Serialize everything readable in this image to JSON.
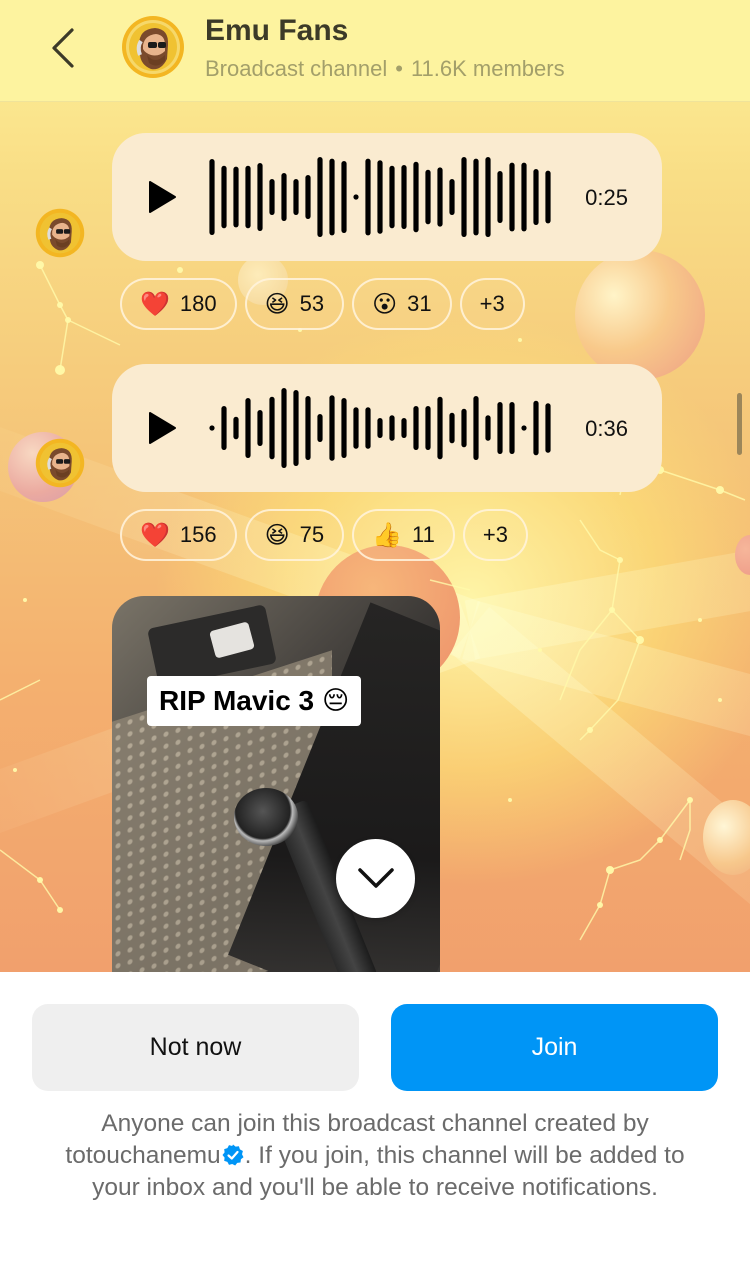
{
  "header": {
    "back_icon": "chevron-left-icon",
    "channel_name": "Emu Fans",
    "channel_type": "Broadcast channel",
    "separator": "•",
    "members": "11.6K members",
    "colors": {
      "background": "#fdf39f",
      "title": "#3c3a28",
      "subtitle": "#a39f6a"
    }
  },
  "messages": [
    {
      "type": "voice",
      "duration": "0:25",
      "waveform": [
        0.95,
        0.78,
        0.76,
        0.78,
        0.85,
        0.45,
        0.6,
        0.45,
        0.55,
        1.0,
        0.96,
        0.9,
        0.0,
        0.96,
        0.92,
        0.78,
        0.8,
        0.88,
        0.68,
        0.74,
        0.45,
        1.0,
        0.96,
        1.0,
        0.65,
        0.86,
        0.86,
        0.7,
        0.66
      ],
      "reactions": [
        {
          "emoji": "❤️",
          "icon": "red-heart-emoji",
          "count": "180"
        },
        {
          "emoji": "😆",
          "icon": "laughing-emoji",
          "count": "53"
        },
        {
          "emoji": "😮",
          "icon": "surprised-emoji",
          "count": "31"
        },
        {
          "emoji": "",
          "icon": "",
          "count": "+3"
        }
      ]
    },
    {
      "type": "voice",
      "duration": "0:36",
      "waveform": [
        0.0,
        0.55,
        0.28,
        0.75,
        0.45,
        0.78,
        1.0,
        0.95,
        0.8,
        0.35,
        0.82,
        0.75,
        0.52,
        0.52,
        0.25,
        0.32,
        0.25,
        0.55,
        0.55,
        0.78,
        0.38,
        0.48,
        0.8,
        0.32,
        0.65,
        0.65,
        0.0,
        0.68,
        0.62
      ],
      "reactions": [
        {
          "emoji": "❤️",
          "icon": "red-heart-emoji",
          "count": "156"
        },
        {
          "emoji": "😆",
          "icon": "laughing-emoji",
          "count": "75"
        },
        {
          "emoji": "👍",
          "icon": "thumbs-up-emoji",
          "count": "11"
        },
        {
          "emoji": "",
          "icon": "",
          "count": "+3"
        }
      ]
    },
    {
      "type": "image",
      "caption": "RIP Mavic 3",
      "caption_emoji": "😔",
      "description": "Broken drone arm with damaged motor on a desk"
    }
  ],
  "scroll_down_icon": "chevron-down-icon",
  "sheet": {
    "not_now_label": "Not now",
    "join_label": "Join",
    "info_prefix": "Anyone can join this broadcast channel created by ",
    "creator": "totouchanemu",
    "info_suffix": ". If you join, this channel will be added to your inbox and you'll be able to receive notifications.",
    "colors": {
      "join": "#0095f6",
      "not_now": "#efefef",
      "verified": "#0095f6",
      "info_text": "#6b6b6b"
    }
  }
}
